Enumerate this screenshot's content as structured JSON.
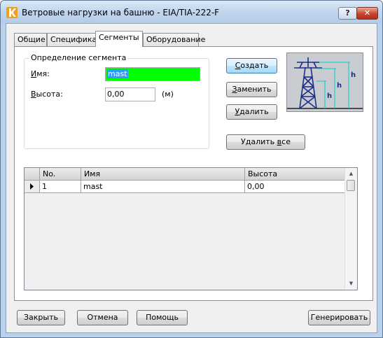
{
  "window": {
    "title": "Ветровые нагрузки на башню - EIA/TIA-222-F",
    "help_label": "?",
    "close_label": "✕"
  },
  "tabs": [
    {
      "label": "Общие"
    },
    {
      "label": "Специфика"
    },
    {
      "label": "Сегменты",
      "active": true
    },
    {
      "label": "Оборудование"
    }
  ],
  "segment": {
    "group_title": "Определение сегмента",
    "name_first": "И",
    "name_rest": "мя:",
    "name_value": "mast",
    "height_first": "В",
    "height_rest": "ысота:",
    "height_value": "0,00",
    "height_unit": "(м)"
  },
  "actions": {
    "create": {
      "ul": "С",
      "rest": "оздать"
    },
    "replace": {
      "ul": "З",
      "rest": "аменить"
    },
    "delete": {
      "ul": "У",
      "rest": "далить"
    },
    "delete_all": {
      "before": "Удалить ",
      "ul": "в",
      "after": "се"
    }
  },
  "diagram": {
    "labels": [
      "h",
      "h",
      "h"
    ],
    "colors": {
      "tower": "#1c2f86",
      "dimension": "#00d0c0"
    }
  },
  "table": {
    "columns": [
      "No.",
      "Имя",
      "Высота"
    ],
    "rows": [
      {
        "no": "1",
        "name": "mast",
        "height": "0,00"
      }
    ]
  },
  "footer": {
    "close": "Закрыть",
    "cancel": "Отмена",
    "help": "Помощь",
    "generate": "Генерировать"
  },
  "colors": {
    "name_field_bg": "#00ff00",
    "selection": "#3399ff",
    "window_frame": "#b9d1ea",
    "close_button": "#c8432f"
  }
}
